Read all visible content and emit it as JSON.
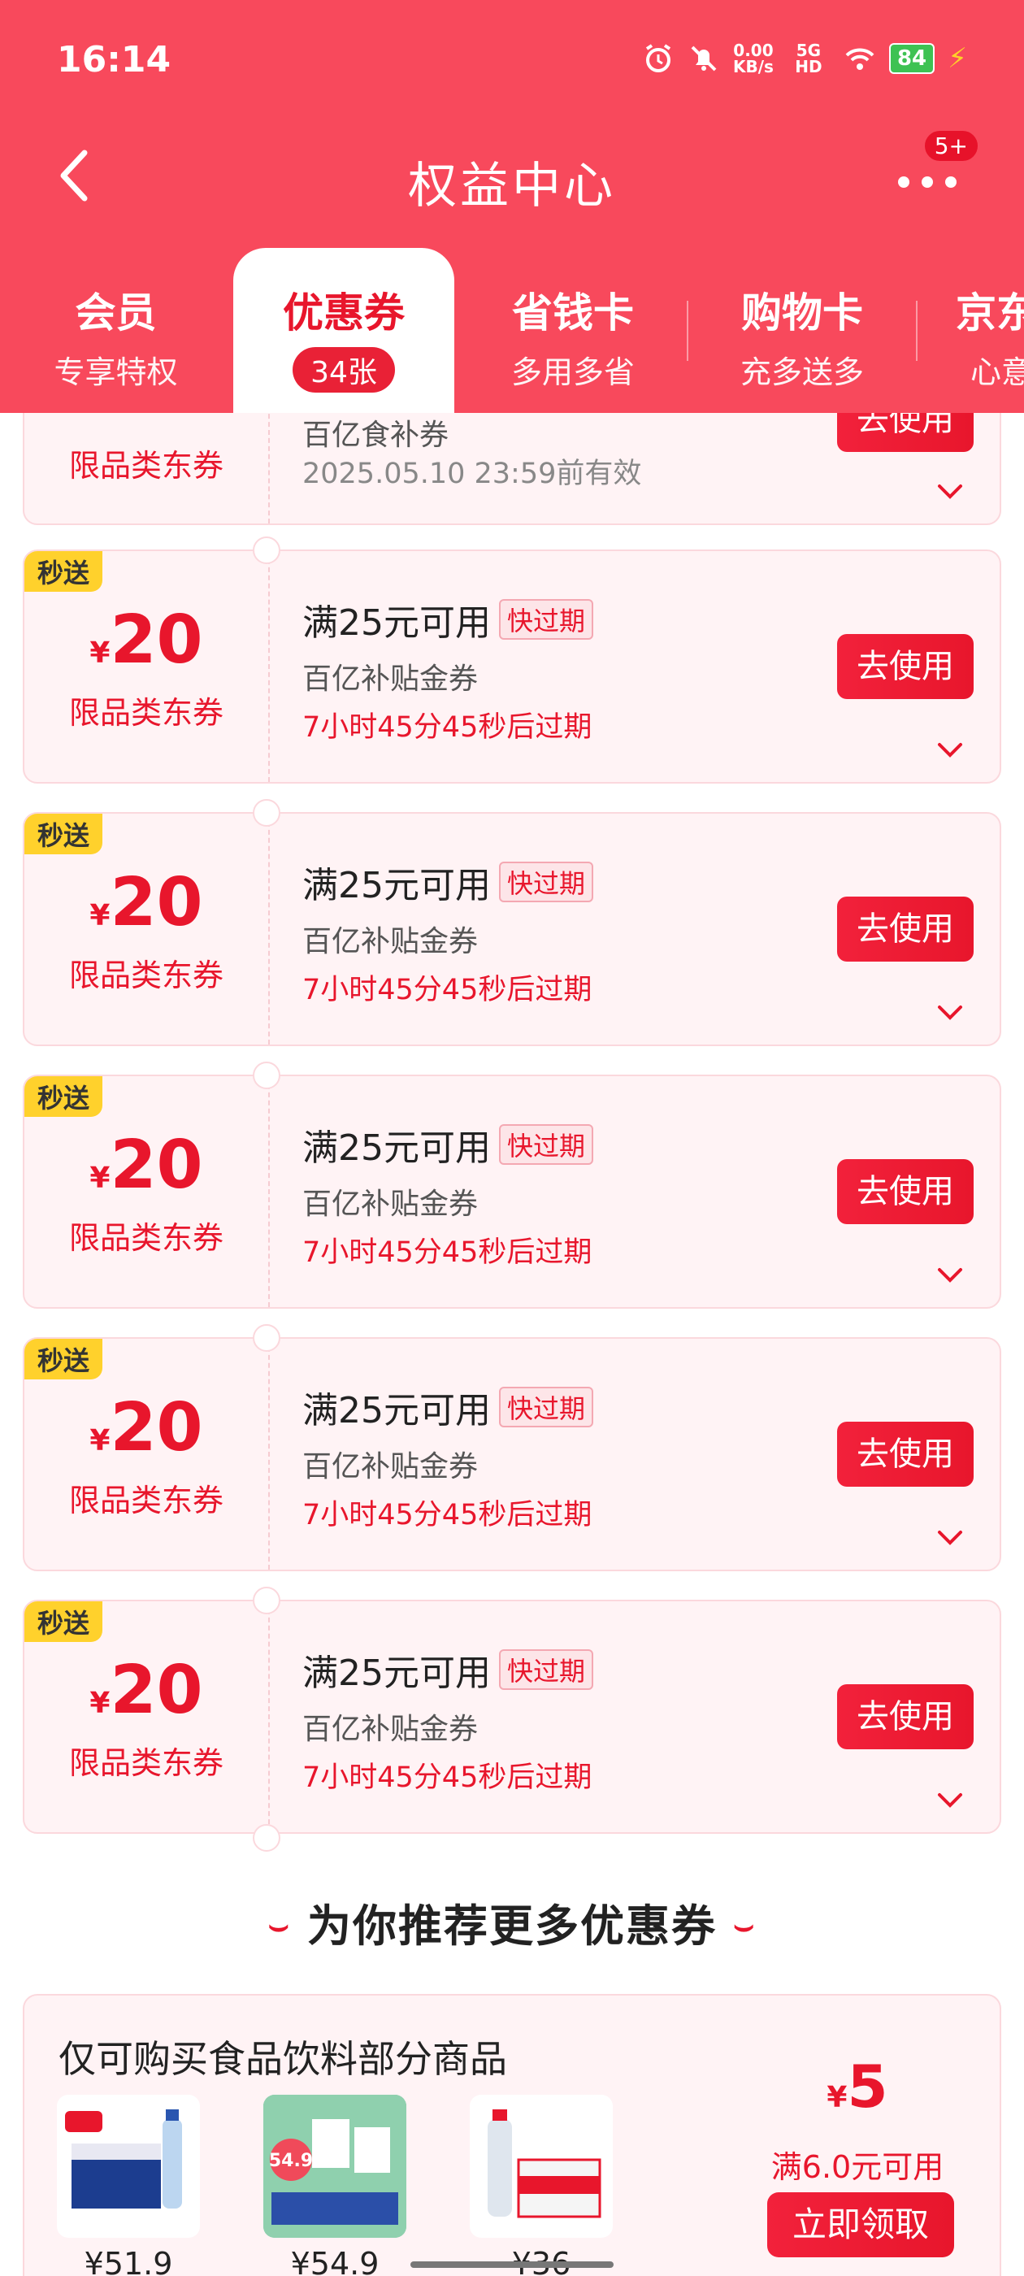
{
  "status_bar": {
    "time": "16:14",
    "net_speed_value": "0.00",
    "net_speed_unit": "KB/s",
    "network": "5G HD",
    "battery": "84"
  },
  "nav": {
    "title": "权益中心",
    "more_badge": "5+"
  },
  "tabs": [
    {
      "label": "会员",
      "sub": "专享特权"
    },
    {
      "label": "优惠券",
      "sub": "34张"
    },
    {
      "label": "省钱卡",
      "sub": "多用多省"
    },
    {
      "label": "购物卡",
      "sub": "充多送多"
    },
    {
      "label": "京东",
      "sub": "心意"
    }
  ],
  "partial_coupon": {
    "scope": "限品类东券",
    "type": "百亿食补券",
    "validity": "2025.05.10 23:59前有效",
    "button": "去使用"
  },
  "coupons": [
    {
      "tag": "秒送",
      "currency": "¥",
      "amount": "20",
      "scope": "限品类东券",
      "condition": "满25元可用",
      "expire_tag": "快过期",
      "type": "百亿补贴金券",
      "countdown": "7小时45分45秒后过期",
      "button": "去使用"
    },
    {
      "tag": "秒送",
      "currency": "¥",
      "amount": "20",
      "scope": "限品类东券",
      "condition": "满25元可用",
      "expire_tag": "快过期",
      "type": "百亿补贴金券",
      "countdown": "7小时45分45秒后过期",
      "button": "去使用"
    },
    {
      "tag": "秒送",
      "currency": "¥",
      "amount": "20",
      "scope": "限品类东券",
      "condition": "满25元可用",
      "expire_tag": "快过期",
      "type": "百亿补贴金券",
      "countdown": "7小时45分45秒后过期",
      "button": "去使用"
    },
    {
      "tag": "秒送",
      "currency": "¥",
      "amount": "20",
      "scope": "限品类东券",
      "condition": "满25元可用",
      "expire_tag": "快过期",
      "type": "百亿补贴金券",
      "countdown": "7小时45分45秒后过期",
      "button": "去使用"
    },
    {
      "tag": "秒送",
      "currency": "¥",
      "amount": "20",
      "scope": "限品类东券",
      "condition": "满25元可用",
      "expire_tag": "快过期",
      "type": "百亿补贴金券",
      "countdown": "7小时45分45秒后过期",
      "button": "去使用"
    }
  ],
  "recommend": {
    "title": "为你推荐更多优惠券",
    "card": {
      "heading": "仅可购买食品饮料部分商品",
      "currency": "¥",
      "amount": "5",
      "condition": "满6.0元可用",
      "button": "立即领取",
      "products": [
        {
          "price": "¥51.9"
        },
        {
          "price": "¥54.9",
          "image_text": "54.9"
        },
        {
          "price": "¥36"
        }
      ]
    }
  },
  "colors": {
    "header": "#f8495c",
    "accent": "#e8162c",
    "card_bg": "#fff3f5",
    "tag_yellow": "#ffd12c"
  }
}
